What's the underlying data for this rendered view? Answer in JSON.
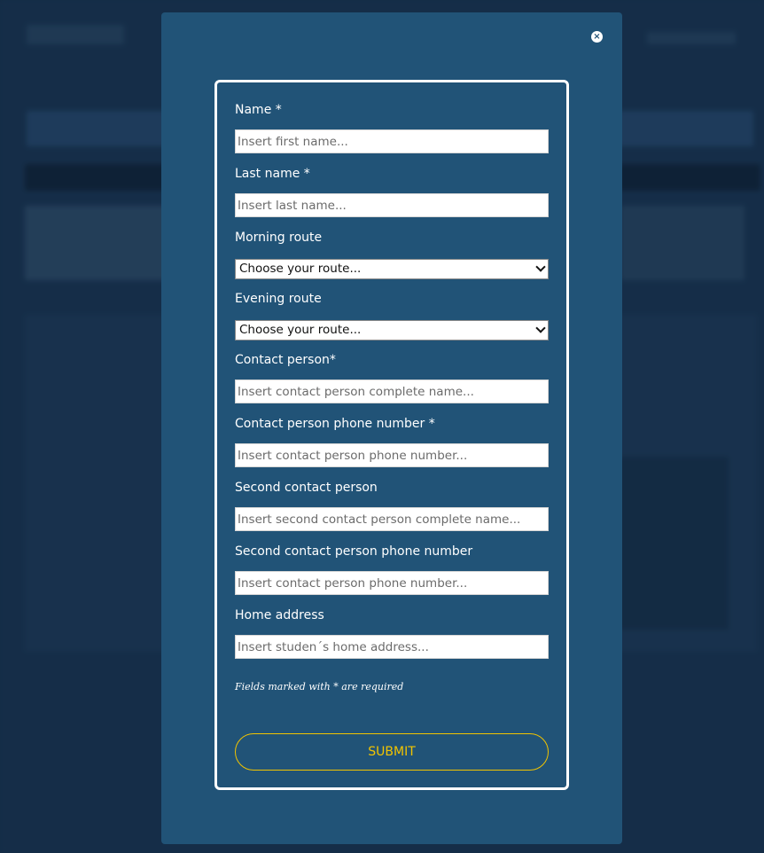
{
  "modal": {
    "close_glyph": "×"
  },
  "form": {
    "name_label": "Name *",
    "name_placeholder": "Insert first name...",
    "lastname_label": "Last name *",
    "lastname_placeholder": "Insert last name...",
    "morning_label": "Morning route",
    "morning_value": "Choose your route...",
    "evening_label": "Evening route",
    "evening_value": "Choose your route...",
    "contact_label": "Contact person*",
    "contact_placeholder": "Insert contact person complete name...",
    "contact_phone_label": "Contact person phone number *",
    "contact_phone_placeholder": "Insert contact person phone number...",
    "second_contact_label": "Second contact person",
    "second_contact_placeholder": "Insert second contact person complete name...",
    "second_phone_label": "Second contact person phone number",
    "second_phone_placeholder": "Insert contact person phone number...",
    "address_label": "Home address",
    "address_placeholder": "Insert studen´s home address...",
    "required_note": "Fields marked with * are required",
    "submit_label": "SUBMIT"
  },
  "colors": {
    "modal_bg": "#215377",
    "accent": "#f2c400",
    "page_bg": "#17324d"
  }
}
